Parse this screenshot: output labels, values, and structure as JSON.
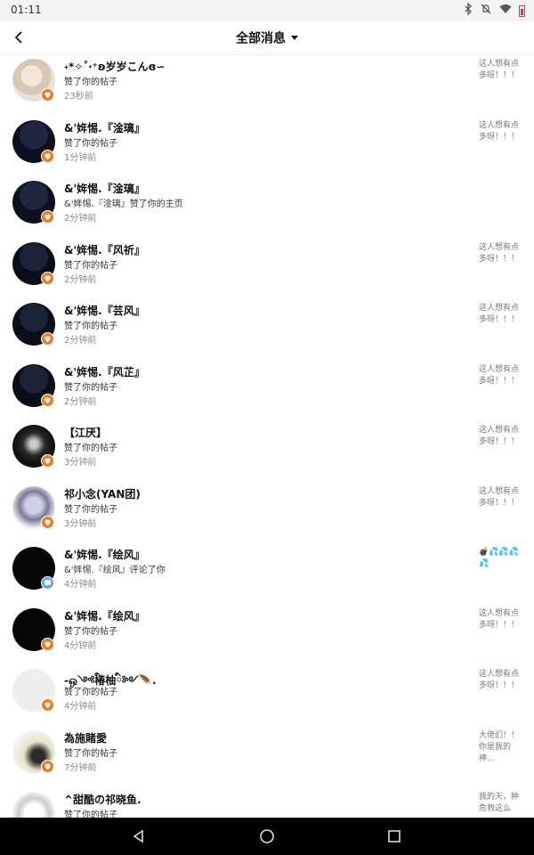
{
  "status_bar": {
    "time": "01:11",
    "icons": [
      "bluetooth-icon",
      "mute-icon",
      "wifi-icon",
      "battery-icon"
    ],
    "battery_color": "#dd3333"
  },
  "header": {
    "title": "全部消息",
    "back_icon": "back-arrow-icon",
    "dropdown_icon": "caret-down-icon"
  },
  "colors": {
    "like_badge": "#f07a22",
    "comment_badge": "#58a6f0",
    "time_text": "#888888"
  },
  "messages": [
    {
      "name": "˖*✧˚‧⁺ʚ岁岁こんɞ∽",
      "action": "赞了你的帖子",
      "time": "23秒前",
      "preview": "这人想有点多呀！！！",
      "badge": "like"
    },
    {
      "name": "&'姩惕.『淦璃』",
      "action": "赞了你的帖子",
      "time": "1分钟前",
      "preview": "这人想有点多呀！！！",
      "badge": "like"
    },
    {
      "name": "&'姩惕.『淦璃』",
      "action": "&'姩惕.『淦璃』赞了你的主页",
      "time": "2分钟前",
      "preview": "",
      "badge": "like"
    },
    {
      "name": "&'姩惕.『风祈』",
      "action": "赞了你的帖子",
      "time": "2分钟前",
      "preview": "这人想有点多呀！！！",
      "badge": "like"
    },
    {
      "name": "&'姩惕.『芸风』",
      "action": "赞了你的帖子",
      "time": "2分钟前",
      "preview": "这人想有点多呀！！！",
      "badge": "like"
    },
    {
      "name": "&'姩惕.『风芷』",
      "action": "赞了你的帖子",
      "time": "2分钟前",
      "preview": "这人想有点多呀！！！",
      "badge": "like"
    },
    {
      "name": "【江厌】",
      "action": "赞了你的帖子",
      "time": "3分钟前",
      "preview": "这人想有点多呀！！！",
      "badge": "like"
    },
    {
      "name": "祁小念(YAN团)",
      "action": "赞了你的帖子",
      "time": "3分钟前",
      "preview": "这人想有点多呀！！！",
      "badge": "like"
    },
    {
      "name": "&'姩惕.『绘风』",
      "action": "&'姩惕.『绘风』评论了你",
      "time": "4分钟前",
      "preview": "💣💦💦💦💦",
      "badge": "comment"
    },
    {
      "name": "&'姩惕.『绘风』",
      "action": "赞了你的帖子",
      "time": "4分钟前",
      "preview": "这人想有点多呀！！！",
      "badge": "like"
    },
    {
      "name": "-ஒ༺ི椿柚ི༻🪶.",
      "action": "赞了你的帖子",
      "time": "4分钟前",
      "preview": "这人想有点多呀！！！",
      "badge": "like"
    },
    {
      "name": "為施賭愛",
      "action": "赞了你的帖子",
      "time": "7分钟前",
      "preview": "大佬们！！你是我的神...",
      "badge": "like"
    },
    {
      "name": "^甜酷の祁晓鱼.",
      "action": "赞了你的帖子",
      "time": "",
      "preview": "我的天，肿危救这么",
      "badge": "like"
    }
  ],
  "nav_bar": {
    "buttons": [
      "back-triangle-icon",
      "home-circle-icon",
      "recents-square-icon"
    ]
  }
}
